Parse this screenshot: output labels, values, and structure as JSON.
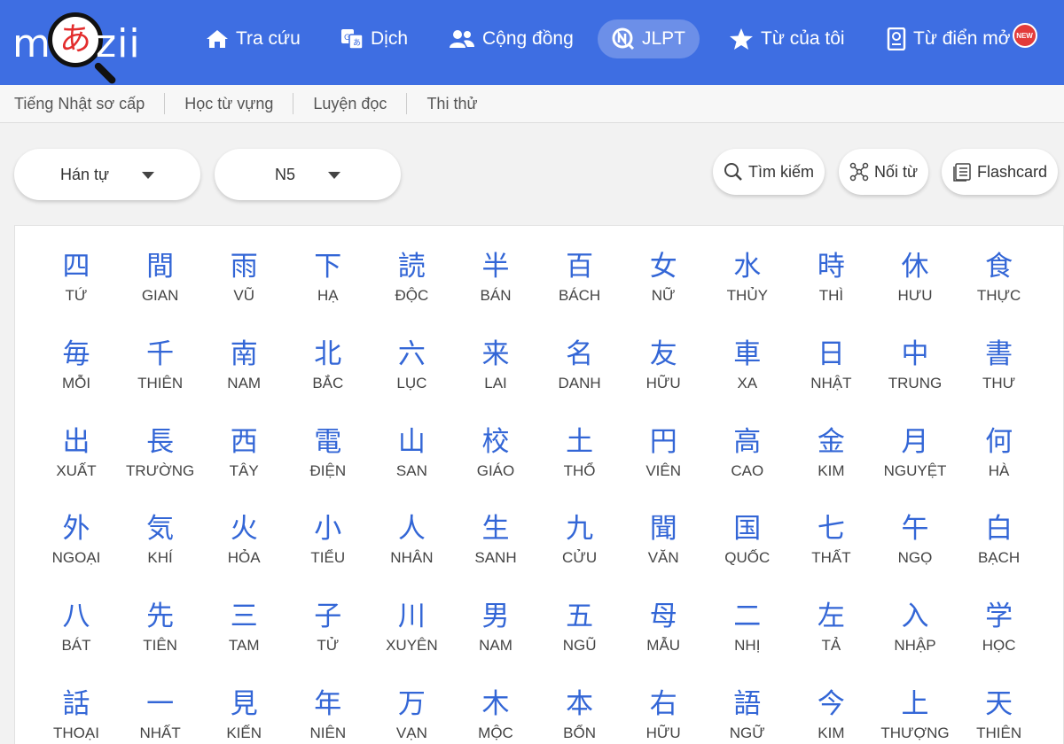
{
  "logo": {
    "left": "m",
    "glyph": "あ",
    "right": "zii"
  },
  "nav": [
    {
      "label": "Tra cứu",
      "icon": "home-icon"
    },
    {
      "label": "Dịch",
      "icon": "translate-icon"
    },
    {
      "label": "Cộng đồng",
      "icon": "community-icon"
    },
    {
      "label": "JLPT",
      "icon": "jlpt-icon",
      "active": true
    },
    {
      "label": "Từ của tôi",
      "icon": "star-icon"
    },
    {
      "label": "Từ điển mở",
      "icon": "dictionary-icon",
      "badge": "NEW"
    }
  ],
  "subnav": [
    "Tiếng Nhật sơ cấp",
    "Học từ vựng",
    "Luyện đọc",
    "Thi thử"
  ],
  "filters": {
    "type": "Hán tự",
    "level": "N5"
  },
  "tools": {
    "search": "Tìm kiếm",
    "match": "Nối từ",
    "flashcard": "Flashcard"
  },
  "colors": {
    "brand": "#3e6ee2",
    "kanji": "#3366d6"
  },
  "kanji": [
    {
      "c": "四",
      "r": "TỨ"
    },
    {
      "c": "間",
      "r": "GIAN"
    },
    {
      "c": "雨",
      "r": "VŨ"
    },
    {
      "c": "下",
      "r": "HẠ"
    },
    {
      "c": "読",
      "r": "ĐỘC"
    },
    {
      "c": "半",
      "r": "BÁN"
    },
    {
      "c": "百",
      "r": "BÁCH"
    },
    {
      "c": "女",
      "r": "NỮ"
    },
    {
      "c": "水",
      "r": "THỦY"
    },
    {
      "c": "時",
      "r": "THÌ"
    },
    {
      "c": "休",
      "r": "HƯU"
    },
    {
      "c": "食",
      "r": "THỰC"
    },
    {
      "c": "毎",
      "r": "MỖI"
    },
    {
      "c": "千",
      "r": "THIÊN"
    },
    {
      "c": "南",
      "r": "NAM"
    },
    {
      "c": "北",
      "r": "BẮC"
    },
    {
      "c": "六",
      "r": "LỤC"
    },
    {
      "c": "来",
      "r": "LAI"
    },
    {
      "c": "名",
      "r": "DANH"
    },
    {
      "c": "友",
      "r": "HỮU"
    },
    {
      "c": "車",
      "r": "XA"
    },
    {
      "c": "日",
      "r": "NHẬT"
    },
    {
      "c": "中",
      "r": "TRUNG"
    },
    {
      "c": "書",
      "r": "THƯ"
    },
    {
      "c": "出",
      "r": "XUẤT"
    },
    {
      "c": "長",
      "r": "TRƯỜNG"
    },
    {
      "c": "西",
      "r": "TÂY"
    },
    {
      "c": "電",
      "r": "ĐIỆN"
    },
    {
      "c": "山",
      "r": "SAN"
    },
    {
      "c": "校",
      "r": "GIÁO"
    },
    {
      "c": "土",
      "r": "THỔ"
    },
    {
      "c": "円",
      "r": "VIÊN"
    },
    {
      "c": "高",
      "r": "CAO"
    },
    {
      "c": "金",
      "r": "KIM"
    },
    {
      "c": "月",
      "r": "NGUYỆT"
    },
    {
      "c": "何",
      "r": "HÀ"
    },
    {
      "c": "外",
      "r": "NGOẠI"
    },
    {
      "c": "気",
      "r": "KHÍ"
    },
    {
      "c": "火",
      "r": "HỎA"
    },
    {
      "c": "小",
      "r": "TIỂU"
    },
    {
      "c": "人",
      "r": "NHÂN"
    },
    {
      "c": "生",
      "r": "SANH"
    },
    {
      "c": "九",
      "r": "CỬU"
    },
    {
      "c": "聞",
      "r": "VĂN"
    },
    {
      "c": "国",
      "r": "QUỐC"
    },
    {
      "c": "七",
      "r": "THẤT"
    },
    {
      "c": "午",
      "r": "NGỌ"
    },
    {
      "c": "白",
      "r": "BẠCH"
    },
    {
      "c": "八",
      "r": "BÁT"
    },
    {
      "c": "先",
      "r": "TIÊN"
    },
    {
      "c": "三",
      "r": "TAM"
    },
    {
      "c": "子",
      "r": "TỬ"
    },
    {
      "c": "川",
      "r": "XUYÊN"
    },
    {
      "c": "男",
      "r": "NAM"
    },
    {
      "c": "五",
      "r": "NGŨ"
    },
    {
      "c": "母",
      "r": "MẪU"
    },
    {
      "c": "二",
      "r": "NHỊ"
    },
    {
      "c": "左",
      "r": "TẢ"
    },
    {
      "c": "入",
      "r": "NHẬP"
    },
    {
      "c": "学",
      "r": "HỌC"
    },
    {
      "c": "話",
      "r": "THOẠI"
    },
    {
      "c": "一",
      "r": "NHẤT"
    },
    {
      "c": "見",
      "r": "KIẾN"
    },
    {
      "c": "年",
      "r": "NIÊN"
    },
    {
      "c": "万",
      "r": "VẠN"
    },
    {
      "c": "木",
      "r": "MỘC"
    },
    {
      "c": "本",
      "r": "BỔN"
    },
    {
      "c": "右",
      "r": "HỮU"
    },
    {
      "c": "語",
      "r": "NGỮ"
    },
    {
      "c": "今",
      "r": "KIM"
    },
    {
      "c": "上",
      "r": "THƯỢNG"
    },
    {
      "c": "天",
      "r": "THIÊN"
    }
  ]
}
